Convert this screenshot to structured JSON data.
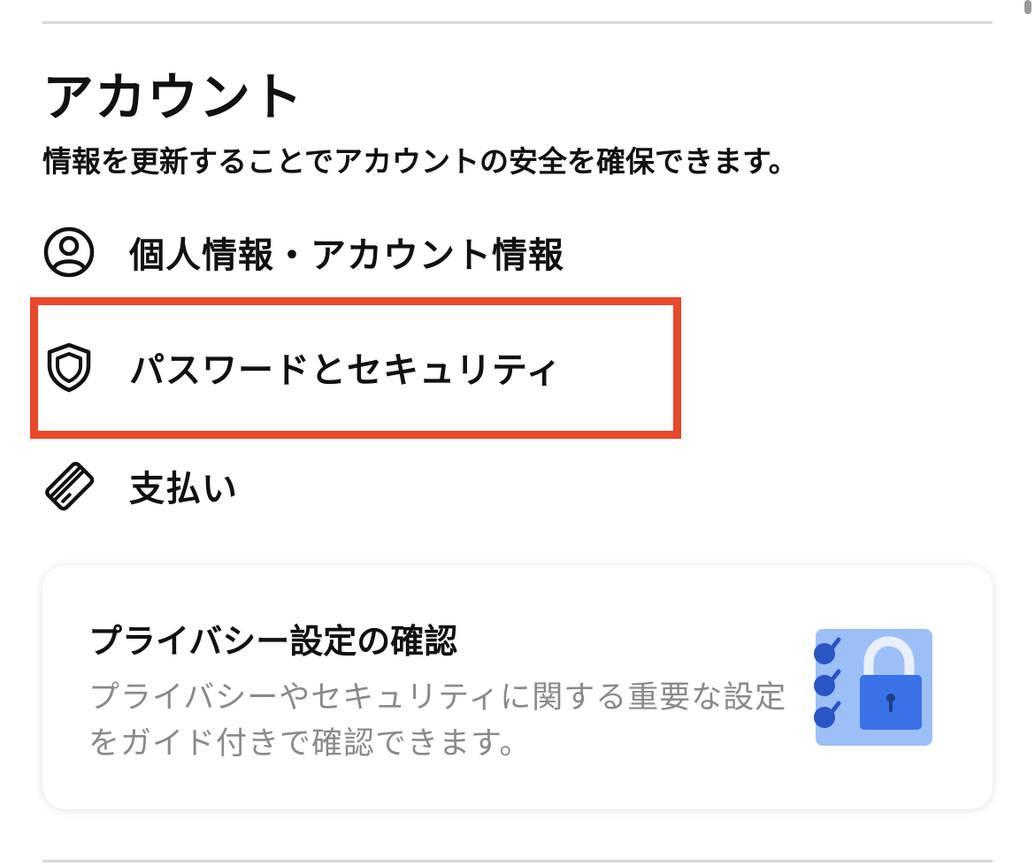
{
  "account": {
    "title": "アカウント",
    "subtitle": "情報を更新することでアカウントの安全を確保できます。",
    "items": [
      {
        "label": "個人情報・アカウント情報",
        "icon": "user-circle-icon"
      },
      {
        "label": "パスワードとセキュリティ",
        "icon": "shield-icon"
      },
      {
        "label": "支払い",
        "icon": "credit-card-icon"
      }
    ]
  },
  "privacy_card": {
    "title": "プライバシー設定の確認",
    "description": "プライバシーやセキュリティに関する重要な設定をガイド付きで確認できます。",
    "illustration": "lock-checklist-icon"
  },
  "colors": {
    "highlight": "#e8482b",
    "text": "#111111",
    "secondary_text": "#8a8a8a",
    "illustration_bg": "#9dbff7",
    "illustration_lock": "#3a72e8",
    "illustration_check": "#2a55c4"
  }
}
